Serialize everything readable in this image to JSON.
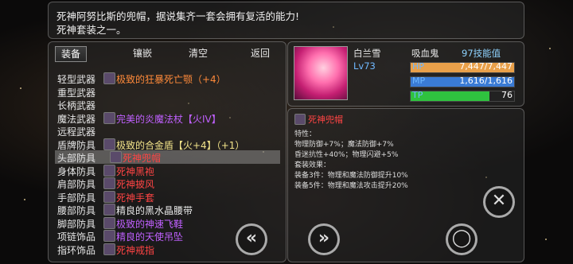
{
  "description": {
    "line1": "死神阿努比斯的兜帽，据说集齐一套会拥有复活的能力!",
    "line2": "死神套装之一。"
  },
  "tabs": [
    {
      "label": "装备"
    },
    {
      "label": "镶嵌"
    },
    {
      "label": "清空"
    },
    {
      "label": "返回"
    }
  ],
  "slots": [
    {
      "label": "轻型武器",
      "item": "极致的狂暴死亡颚（+4）",
      "color": "orange",
      "icon": "jaw-weapon-icon"
    },
    {
      "label": "重型武器",
      "item": "",
      "color": "white",
      "icon": ""
    },
    {
      "label": "长柄武器",
      "item": "",
      "color": "white",
      "icon": ""
    },
    {
      "label": "魔法武器",
      "item": "完美的炎魔法杖【火IV】",
      "color": "purple",
      "icon": "staff-icon"
    },
    {
      "label": "远程武器",
      "item": "",
      "color": "white",
      "icon": ""
    },
    {
      "label": "盾牌防具",
      "item": "极致的合金盾【火+4】（+1）",
      "color": "yellow",
      "icon": "shield-icon"
    },
    {
      "label": "头部防具",
      "item": "死神兜帽",
      "color": "red",
      "icon": "hood-icon"
    },
    {
      "label": "身体防具",
      "item": "死神黑袍",
      "color": "red",
      "icon": "robe-icon"
    },
    {
      "label": "肩部防具",
      "item": "死神披风",
      "color": "red",
      "icon": "cape-icon"
    },
    {
      "label": "手部防具",
      "item": "死神手套",
      "color": "red",
      "icon": "glove-icon"
    },
    {
      "label": "腰部防具",
      "item": "精良的黑水晶腰带",
      "color": "white",
      "icon": "belt-icon"
    },
    {
      "label": "脚部防具",
      "item": "极致的神速飞鞋",
      "color": "purple",
      "icon": "boots-icon"
    },
    {
      "label": "项链饰品",
      "item": "精良的天使吊坠",
      "color": "purple",
      "icon": "pendant-icon"
    },
    {
      "label": "指环饰品",
      "item": "死神戒指",
      "color": "red",
      "icon": "ring-icon"
    }
  ],
  "character": {
    "name": "白兰雪",
    "level": "Lv73",
    "title": "吸血鬼",
    "skill_points": "97技能值",
    "hp_label": "HP",
    "hp_value": "7,447/7,447",
    "hp_ratio": 1.0,
    "mp_label": "MP",
    "mp_value": "1,616/1,616",
    "mp_ratio": 1.0,
    "tp_label": "TP",
    "tp_value": "76",
    "tp_ratio": 0.76
  },
  "detail": {
    "item_name": "死神兜帽",
    "lines": [
      "特性：",
      "物理防御+7%；魔法防御+7%",
      "昏迷抗性+40%；物理闪避+5%",
      "套装效果：",
      "装备3件：物理和魔法防御提升10%",
      "装备5件：物理和魔法攻击提升20%"
    ]
  },
  "colors": {
    "orange": "#ff8a3a",
    "purple": "#c060ff",
    "yellow": "#f3e48a",
    "white": "#e8e8e8",
    "red": "#ff4444",
    "hp_fill": "#e9a04a",
    "mp_fill": "#3a7bd5",
    "tp_fill": "#2fc23f"
  },
  "buttons": {
    "prev_icon": "double-chevron-left-icon",
    "next_icon": "double-chevron-right-icon",
    "close_icon": "close-icon",
    "confirm_icon": "circle-icon"
  }
}
